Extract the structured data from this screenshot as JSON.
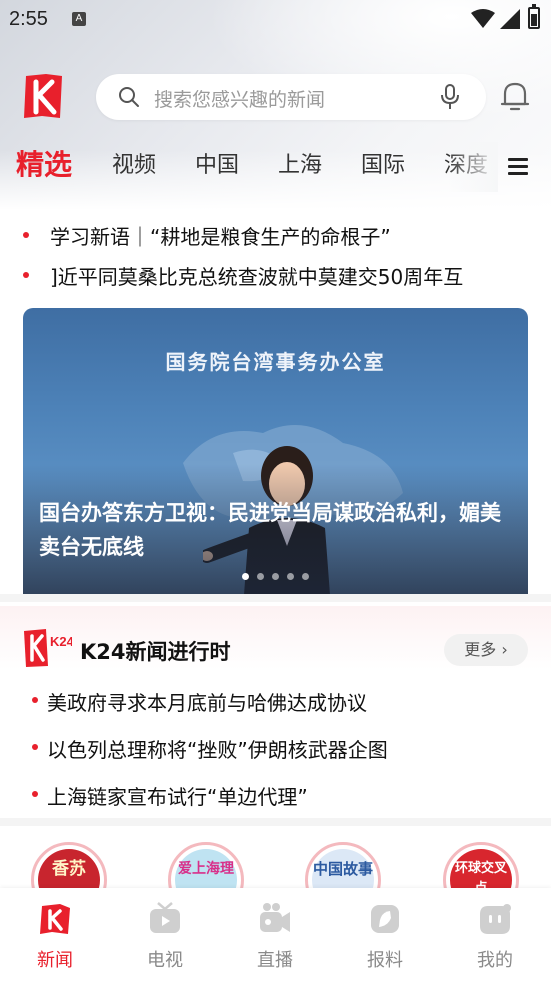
{
  "status_bar": {
    "time": "2:55",
    "notification_icon": "A"
  },
  "top_bar": {
    "logo_icon": "k-logo-icon",
    "search_placeholder": "搜索您感兴趣的新闻",
    "mic_icon": "mic-icon",
    "bell_icon": "bell-icon"
  },
  "tabs": [
    {
      "label": "精选",
      "active": true
    },
    {
      "label": "视频"
    },
    {
      "label": "中国"
    },
    {
      "label": "上海"
    },
    {
      "label": "国际"
    },
    {
      "label": "深度"
    }
  ],
  "headlines": [
    "学习新语｜“耕地是粮食生产的命根子”",
    "]近平同莫桑比克总统查波就中莫建交50周年互"
  ],
  "banner": {
    "sign_text": "国务院台湾事务办公室",
    "caption": "国台办答东方卫视：民进党当局谋政治私利，媚美卖台无底线",
    "dots": 5,
    "active_dot": 0
  },
  "k24": {
    "logo_text": "K24",
    "title": "K24新闻进行时",
    "more_label": "更多",
    "items": [
      "美政府寻求本月底前与哈佛达成协议",
      "以色列总理称将“挫败”伊朗核武器企图",
      "上海链家宣布试行“单边代理”"
    ]
  },
  "shortcuts": [
    {
      "text": "香苏",
      "color": "#c8252e"
    },
    {
      "text": "爱上海理",
      "color": "#6fb9d8"
    },
    {
      "text": "中国故事",
      "color": "#2c5aa0"
    },
    {
      "text": "环球交叉点",
      "color": "#d8262e"
    }
  ],
  "bottom_nav": [
    {
      "label": "新闻",
      "icon": "news-icon",
      "active": true
    },
    {
      "label": "电视",
      "icon": "tv-icon"
    },
    {
      "label": "直播",
      "icon": "live-camera-icon"
    },
    {
      "label": "报料",
      "icon": "report-icon"
    },
    {
      "label": "我的",
      "icon": "profile-icon"
    }
  ],
  "colors": {
    "accent": "#e8202c"
  }
}
